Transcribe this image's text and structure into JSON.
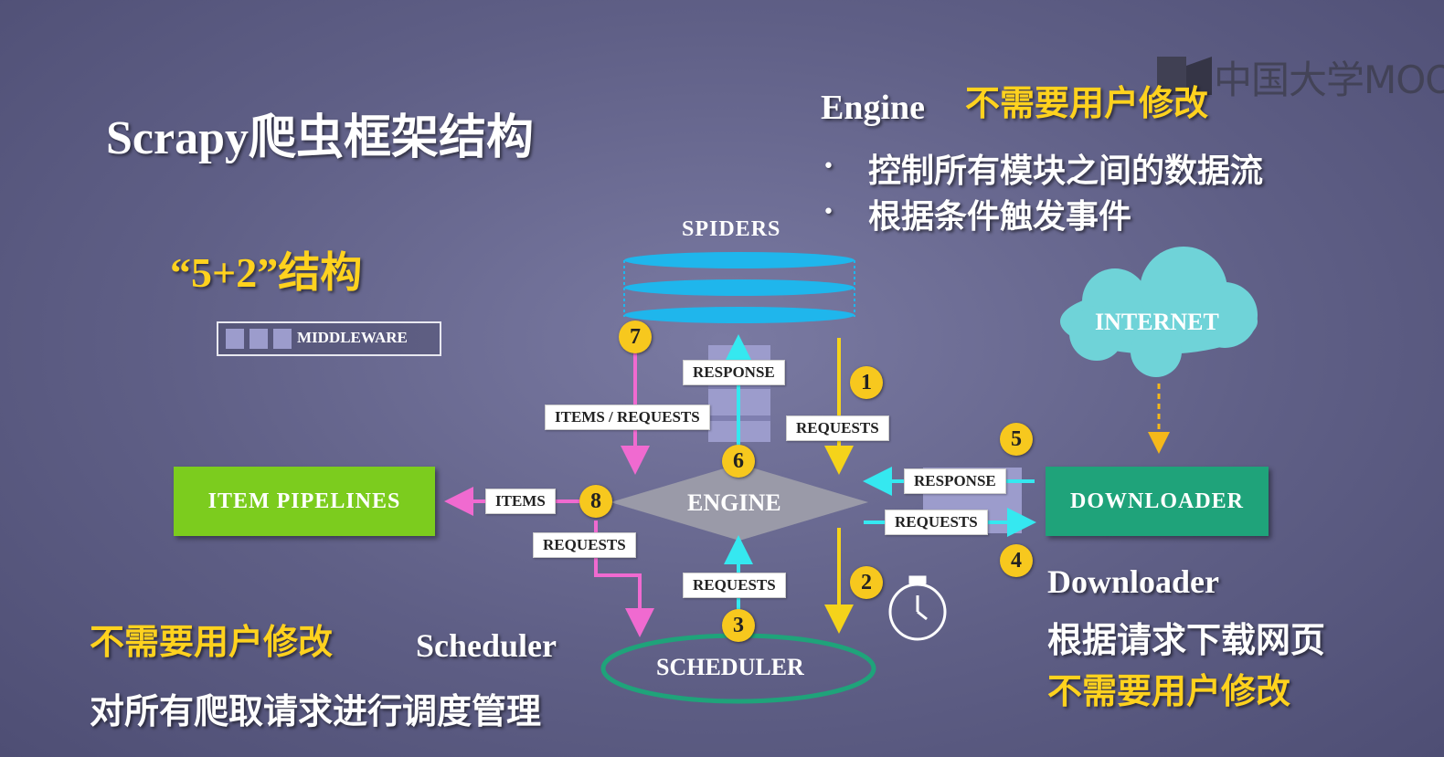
{
  "watermark": {
    "text": "中国大学MOOC"
  },
  "title": {
    "text": "Scrapy爬虫框架结构"
  },
  "subtitle": {
    "text": "“5+2”结构"
  },
  "legend": {
    "middleware": "MIDDLEWARE"
  },
  "engine_desc": {
    "name": "Engine",
    "note": "不需要用户修改",
    "bullets": [
      "控制所有模块之间的数据流",
      "根据条件触发事件"
    ]
  },
  "components": {
    "spiders": "SPIDERS",
    "internet": "INTERNET",
    "item_pipelines": "ITEM PIPELINES",
    "engine": "ENGINE",
    "downloader": "DOWNLOADER",
    "scheduler": "SCHEDULER"
  },
  "flow_labels": {
    "response_top": "RESPONSE",
    "items_requests": "ITEMS / REQUESTS",
    "requests_1": "REQUESTS",
    "response_right": "RESPONSE",
    "requests_right": "REQUESTS",
    "items": "ITEMS",
    "requests_left": "REQUESTS",
    "requests_bottom": "REQUESTS"
  },
  "steps": [
    "1",
    "2",
    "3",
    "4",
    "5",
    "6",
    "7",
    "8"
  ],
  "scheduler_desc": {
    "note": "不需要用户修改",
    "name": "Scheduler",
    "desc": "对所有爬取请求进行调度管理"
  },
  "downloader_desc": {
    "name": "Downloader",
    "desc": "根据请求下载网页",
    "note": "不需要用户修改"
  },
  "icons": [
    "stopwatch-icon",
    "cloud-icon",
    "mooc-logo-icon"
  ],
  "colors": {
    "background": "#64648c",
    "yellow": "#ffd21e",
    "pipelines_green": "#7ccc1e",
    "downloader_teal": "#1fa37a",
    "cloud_cyan": "#6fd3d8",
    "spider_blue": "#1fb6ec",
    "engine_gray": "#9a9aa8",
    "arrow_pink": "#f06ad0",
    "arrow_cyan": "#35e8f0"
  }
}
